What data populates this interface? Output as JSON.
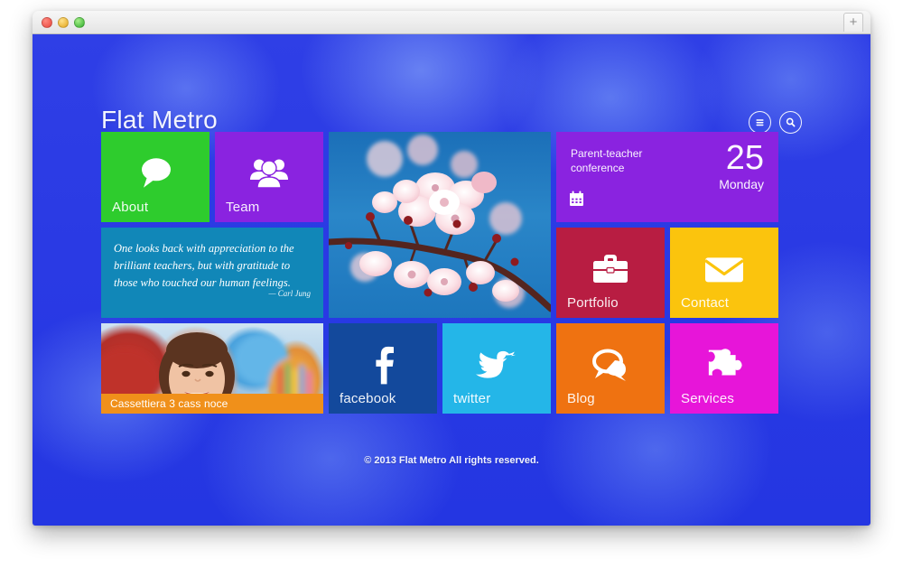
{
  "window": {
    "traffic_lights": [
      "close",
      "minimize",
      "zoom"
    ],
    "new_tab_label": "+"
  },
  "site": {
    "brand": "Flat Metro",
    "header_icons": [
      {
        "name": "menu-icon",
        "glyph": "≡"
      },
      {
        "name": "search-icon",
        "glyph": "⌕"
      }
    ]
  },
  "tiles": {
    "about": {
      "label": "About",
      "icon": "speech-bubble-icon",
      "color": "#2ecc2d"
    },
    "team": {
      "label": "Team",
      "icon": "group-people-icon",
      "color": "#8a23e0"
    },
    "portfolio": {
      "label": "Portfolio",
      "icon": "briefcase-icon",
      "color": "#b81d42"
    },
    "contact": {
      "label": "Contact",
      "icon": "envelope-icon",
      "color": "#fbc40d"
    },
    "facebook": {
      "label": "facebook",
      "icon": "facebook-icon",
      "color": "#13499c"
    },
    "twitter": {
      "label": "twitter",
      "icon": "twitter-bird-icon",
      "color": "#24b6e8"
    },
    "blog": {
      "label": "Blog",
      "icon": "chat-bubbles-icon",
      "color": "#ef7211"
    },
    "services": {
      "label": "Services",
      "icon": "puzzle-piece-icon",
      "color": "#e715d9"
    }
  },
  "quote": {
    "text": "One looks back with appreciation to the brilliant teachers, but with gratitude to those who touched our human feelings.",
    "author": "— Carl Jung",
    "color": "#1187b8"
  },
  "calendar": {
    "title": "Parent-teacher conference",
    "day": "25",
    "weekday": "Monday",
    "icon": "calendar-icon",
    "color": "#8a23e0"
  },
  "photo_tile": {
    "alt": "cherry-blossom-photo"
  },
  "kids_tile": {
    "alt": "smiling-schoolgirl-photo",
    "caption": "Cassettiera 3 cass noce",
    "caption_color": "#f0901a"
  },
  "footer": {
    "text": "© 2013 Flat Metro All rights reserved."
  },
  "theme": {
    "background_blue": "#2a3ae4",
    "text_white": "#ffffff"
  }
}
